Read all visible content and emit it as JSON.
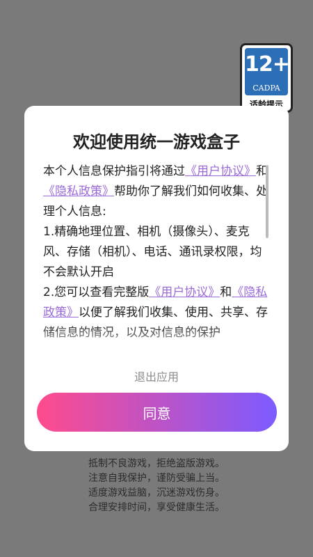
{
  "age_badge": {
    "rating": "12+",
    "org": "CADPA",
    "tip": "适龄提示"
  },
  "notice": {
    "lines": [
      "抵制不良游戏，拒绝盗版游戏。",
      "注意自我保护，谨防受骗上当。",
      "适度游戏益脑，沉迷游戏伤身。",
      "合理安排时间，享受健康生活。"
    ]
  },
  "dialog": {
    "title": "欢迎使用统一游戏盒子",
    "body": {
      "p1_a": "本个人信息保护指引将通过",
      "user_agreement": "《用户协议》",
      "and": "和",
      "privacy_policy": "《隐私政策》",
      "p1_b": "帮助你了解我们如何收集、处理个人信息:",
      "p2": "1.精确地理位置、相机（摄像头）、麦克风、存储（相机）、电话、通讯录权限，均不会默认开启",
      "p3_a": "2.您可以查看完整版",
      "p3_b": "以便了解我们收集、使用、共享、存储信息的情况，以及对信息的保护"
    },
    "exit_label": "退出应用",
    "agree_label": "同意"
  },
  "colors": {
    "link": "#9a6bd8",
    "agree_gradient_start": "#ff4b8d",
    "agree_gradient_end": "#7c5bff",
    "overlay": "#7a7a7a"
  }
}
